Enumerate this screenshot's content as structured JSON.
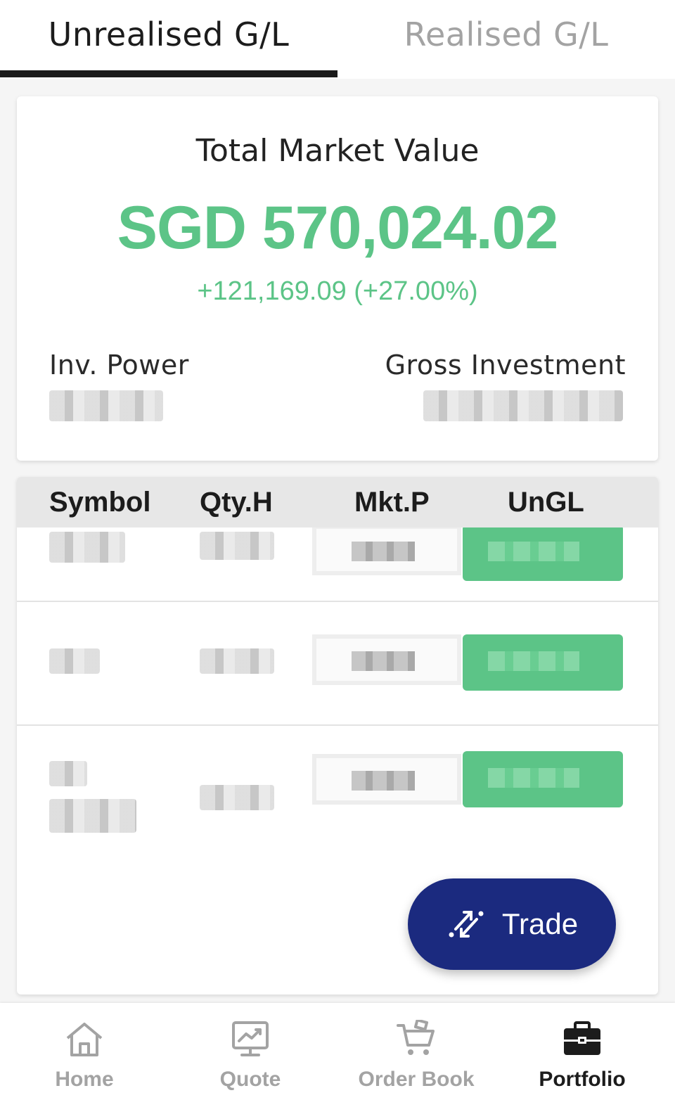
{
  "colors": {
    "gain_green": "#5cc487",
    "navy": "#1b2a7f",
    "inactive_gray": "#a3a3a3"
  },
  "tabs": [
    {
      "label": "Unrealised G/L",
      "active": true
    },
    {
      "label": "Realised G/L",
      "active": false
    }
  ],
  "summary": {
    "title": "Total Market Value",
    "value": "SGD 570,024.02",
    "change": "+121,169.09 (+27.00%)",
    "inv_power_label": "Inv. Power",
    "gross_investment_label": "Gross Investment"
  },
  "holdings": {
    "columns": [
      "Symbol",
      "Qty.H",
      "Mkt.P",
      "UnGL"
    ],
    "row_count": 3
  },
  "fab": {
    "label": "Trade",
    "icon": "trade-arrows-icon"
  },
  "nav": [
    {
      "label": "Home",
      "icon": "home-icon",
      "active": false
    },
    {
      "label": "Quote",
      "icon": "quote-chart-icon",
      "active": false
    },
    {
      "label": "Order Book",
      "icon": "cart-icon",
      "active": false
    },
    {
      "label": "Portfolio",
      "icon": "briefcase-icon",
      "active": true
    }
  ]
}
